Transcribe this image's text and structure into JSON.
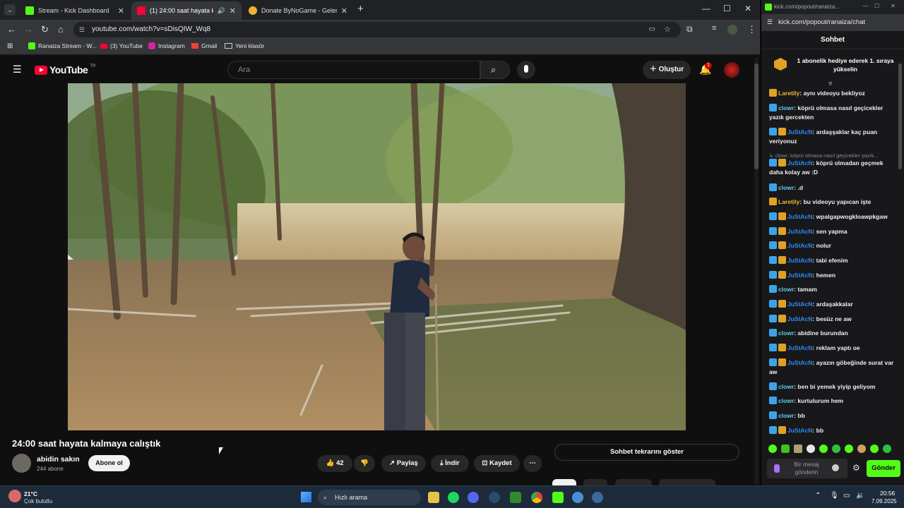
{
  "browser": {
    "tabs": [
      {
        "title": "Stream - Kick Dashboard",
        "color": "#53fc18"
      },
      {
        "title": "(1) 24:00 saat hayata kalma",
        "color": "#ff0033"
      },
      {
        "title": "Donate ByNoGame - Gelen/Gi",
        "color": "#f0b030"
      }
    ],
    "new_tab": "+",
    "url": "youtube.com/watch?v=sDisQIW_Wq8",
    "bookmarks": [
      "Ranaiza Stream - W...",
      "(3) YouTube",
      "Instagram",
      "Gmail",
      "Yeni klasör"
    ]
  },
  "youtube": {
    "logo": "YouTube",
    "region": "TR",
    "search_placeholder": "Ara",
    "create_label": "Oluştur",
    "notif_count": "1",
    "video_title": "24:00 saat hayata kalmaya calıştık",
    "channel_name": "abidin sakın",
    "subscribers": "244 abone",
    "subscribe_label": "Abone ol",
    "likes": "42",
    "share_label": "Paylaş",
    "download_label": "İndir",
    "save_label": "Kaydet",
    "replay_chat_label": "Sohbet tekrarını göster"
  },
  "chat": {
    "window_title": "kick.com/popout/ranaiza...",
    "url": "kick.com/popout/ranaiza/chat",
    "header": "Sohbet",
    "pinned": "1 abonelik hediye ederek 1. sıraya yükselin",
    "reply_preview": "↳ clowr: köprü olmasa nasıl geçicekler yazık...",
    "messages": [
      {
        "user": "Laretily",
        "text": "aynı videoyu bekliyoz",
        "cls": "u-gold",
        "badges": 1
      },
      {
        "user": "clowr",
        "text": "köprü olmasa nasıl geçicekler yazık gercekten",
        "cls": "u-cyan",
        "badges": 1
      },
      {
        "user": "JuStAcN",
        "text": "ardaşşaklar kaç puan veriyonuz",
        "cls": "u-blue",
        "badges": 2
      },
      {
        "user": "JuStAcN",
        "text": "köprü olmadan geçmek daha kolay aw :D",
        "cls": "u-blue",
        "badges": 2
      },
      {
        "user": "clowr",
        "text": ".d",
        "cls": "u-cyan",
        "badges": 1
      },
      {
        "user": "Laretily",
        "text": "bu videoyu yapıcan işte",
        "cls": "u-gold",
        "badges": 1
      },
      {
        "user": "JuStAcN",
        "text": "wpalgapwogkloawpkgaw",
        "cls": "u-blue",
        "badges": 2
      },
      {
        "user": "JuStAcN",
        "text": "sen yapma",
        "cls": "u-blue",
        "badges": 2
      },
      {
        "user": "JuStAcN",
        "text": "nolur",
        "cls": "u-blue",
        "badges": 2
      },
      {
        "user": "JuStAcN",
        "text": "tabi efenim",
        "cls": "u-blue",
        "badges": 2
      },
      {
        "user": "JuStAcN",
        "text": "hemen",
        "cls": "u-blue",
        "badges": 2
      },
      {
        "user": "clowr",
        "text": "tamam",
        "cls": "u-cyan",
        "badges": 1
      },
      {
        "user": "JuStAcN",
        "text": "ardaşakkalar",
        "cls": "u-blue",
        "badges": 2
      },
      {
        "user": "JuStAcN",
        "text": "besüz ne aw",
        "cls": "u-blue",
        "badges": 2
      },
      {
        "user": "clowr",
        "text": "abidine burundan",
        "cls": "u-cyan",
        "badges": 1
      },
      {
        "user": "JuStAcN",
        "text": "reklam yaptı oe",
        "cls": "u-blue",
        "badges": 2
      },
      {
        "user": "JuStAcN",
        "text": "ayazın göbeğinde surat var aw",
        "cls": "u-blue",
        "badges": 2
      },
      {
        "user": "clowr",
        "text": "ben bi yemek yiyip geliyom",
        "cls": "u-cyan",
        "badges": 1
      },
      {
        "user": "clowr",
        "text": "kurtulurum hem",
        "cls": "u-cyan",
        "badges": 1
      },
      {
        "user": "clowr",
        "text": "bb",
        "cls": "u-cyan",
        "badges": 1
      },
      {
        "user": "JuStAcN",
        "text": "bb",
        "cls": "u-blue",
        "badges": 2
      }
    ],
    "input_placeholder": "Bir mesaj gönderin",
    "send_label": "Gönder"
  },
  "taskbar": {
    "temp": "21°C",
    "weather": "Çok bulutlu",
    "search_label": "Hızlı arama",
    "time": "20:56",
    "date": "7.09.2025"
  }
}
